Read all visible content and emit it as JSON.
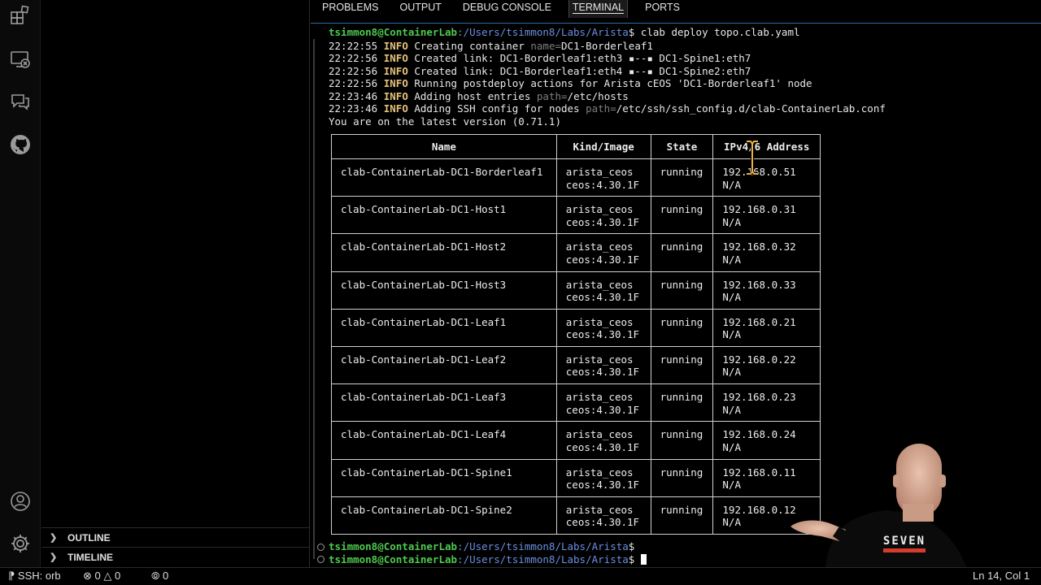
{
  "sidebar": {
    "sections": [
      {
        "label": "OUTLINE"
      },
      {
        "label": "TIMELINE"
      }
    ]
  },
  "panel": {
    "tabs": [
      {
        "label": "PROBLEMS"
      },
      {
        "label": "OUTPUT"
      },
      {
        "label": "DEBUG CONSOLE"
      },
      {
        "label": "TERMINAL",
        "active": true
      },
      {
        "label": "PORTS"
      }
    ]
  },
  "terminal": {
    "prompt_user": "tsimmon8@ContainerLab",
    "prompt_path": ":/Users/tsimmon8/Labs/Arista",
    "prompt_symbol": "$",
    "command": " clab deploy topo.clab.yaml",
    "log": [
      {
        "time": "22:22:55",
        "level": "INFO",
        "pre": " Creating container ",
        "dim": "name=",
        "post": "DC1-Borderleaf1"
      },
      {
        "time": "22:22:56",
        "level": "INFO",
        "pre": " Created link: DC1-Borderleaf1:eth3 ▪--▪ DC1-Spine1:eth7",
        "dim": "",
        "post": ""
      },
      {
        "time": "22:22:56",
        "level": "INFO",
        "pre": " Created link: DC1-Borderleaf1:eth4 ▪--▪ DC1-Spine2:eth7",
        "dim": "",
        "post": ""
      },
      {
        "time": "22:22:56",
        "level": "INFO",
        "pre": " Running postdeploy actions for Arista cEOS 'DC1-Borderleaf1' node",
        "dim": "",
        "post": ""
      },
      {
        "time": "22:23:46",
        "level": "INFO",
        "pre": " Adding host entries ",
        "dim": "path=",
        "post": "/etc/hosts"
      },
      {
        "time": "22:23:46",
        "level": "INFO",
        "pre": " Adding SSH config for nodes ",
        "dim": "path=",
        "post": "/etc/ssh/ssh_config.d/clab-ContainerLab.conf"
      }
    ],
    "version_msg": "You are on the latest version (0.71.1)",
    "table": {
      "headers": [
        "Name",
        "Kind/Image",
        "State",
        "IPv4/6 Address"
      ],
      "rows": [
        {
          "name": "clab-ContainerLab-DC1-Borderleaf1",
          "kind": "arista_ceos",
          "image": "ceos:4.30.1F",
          "state": "running",
          "ipv4": "192.168.0.51",
          "ipv6": "N/A"
        },
        {
          "name": "clab-ContainerLab-DC1-Host1",
          "kind": "arista_ceos",
          "image": "ceos:4.30.1F",
          "state": "running",
          "ipv4": "192.168.0.31",
          "ipv6": "N/A"
        },
        {
          "name": "clab-ContainerLab-DC1-Host2",
          "kind": "arista_ceos",
          "image": "ceos:4.30.1F",
          "state": "running",
          "ipv4": "192.168.0.32",
          "ipv6": "N/A"
        },
        {
          "name": "clab-ContainerLab-DC1-Host3",
          "kind": "arista_ceos",
          "image": "ceos:4.30.1F",
          "state": "running",
          "ipv4": "192.168.0.33",
          "ipv6": "N/A"
        },
        {
          "name": "clab-ContainerLab-DC1-Leaf1",
          "kind": "arista_ceos",
          "image": "ceos:4.30.1F",
          "state": "running",
          "ipv4": "192.168.0.21",
          "ipv6": "N/A"
        },
        {
          "name": "clab-ContainerLab-DC1-Leaf2",
          "kind": "arista_ceos",
          "image": "ceos:4.30.1F",
          "state": "running",
          "ipv4": "192.168.0.22",
          "ipv6": "N/A"
        },
        {
          "name": "clab-ContainerLab-DC1-Leaf3",
          "kind": "arista_ceos",
          "image": "ceos:4.30.1F",
          "state": "running",
          "ipv4": "192.168.0.23",
          "ipv6": "N/A"
        },
        {
          "name": "clab-ContainerLab-DC1-Leaf4",
          "kind": "arista_ceos",
          "image": "ceos:4.30.1F",
          "state": "running",
          "ipv4": "192.168.0.24",
          "ipv6": "N/A"
        },
        {
          "name": "clab-ContainerLab-DC1-Spine1",
          "kind": "arista_ceos",
          "image": "ceos:4.30.1F",
          "state": "running",
          "ipv4": "192.168.0.11",
          "ipv6": "N/A"
        },
        {
          "name": "clab-ContainerLab-DC1-Spine2",
          "kind": "arista_ceos",
          "image": "ceos:4.30.1F",
          "state": "running",
          "ipv4": "192.168.0.12",
          "ipv6": "N/A"
        }
      ]
    },
    "prompt_lines": 2
  },
  "presenter": {
    "shirt_text": "SEVEN"
  },
  "status_bar": {
    "remote": "SSH: orb",
    "errors": "0",
    "warnings": "0",
    "ports": "0",
    "cursor_pos": "Ln 14, Col 1"
  },
  "colors": {
    "info": "#e5c07b",
    "prompt_user": "#4ec94e",
    "prompt_path": "#6b8fe0",
    "accent": "#2e6ea3"
  },
  "icons": [
    "extensions-icon",
    "remote-explorer-icon",
    "chat-icon",
    "github-icon",
    "account-icon",
    "settings-gear-icon"
  ]
}
